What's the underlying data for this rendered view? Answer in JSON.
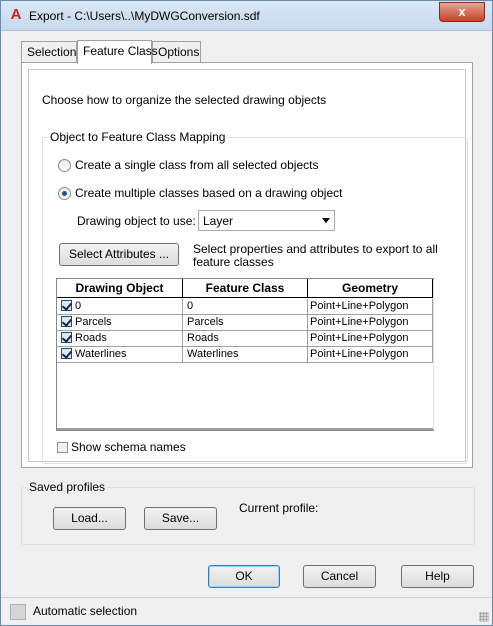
{
  "window": {
    "app_icon": "A",
    "title": "Export - C:\\Users\\..\\MyDWGConversion.sdf",
    "close_glyph": "x",
    "close_icon": "close-icon"
  },
  "tabs": [
    {
      "label": "Selection",
      "active": false
    },
    {
      "label": "Feature Class",
      "active": true
    },
    {
      "label": "Options",
      "active": false
    }
  ],
  "feature_class": {
    "intro": "Choose how to organize the selected drawing objects",
    "group_title": "Object to Feature Class Mapping",
    "radio_single": {
      "label": "Create a single class from all selected objects",
      "checked": false
    },
    "radio_multiple": {
      "label": "Create multiple classes based on a drawing object",
      "checked": true
    },
    "drawing_object_label": "Drawing object to use:",
    "drawing_object_value": "Layer",
    "select_attributes_button": "Select Attributes ...",
    "select_attributes_desc": "Select properties and attributes to export to all feature classes",
    "columns": [
      "Drawing Object",
      "Feature Class",
      "Geometry"
    ],
    "rows": [
      {
        "checked": true,
        "drawing_object": "0",
        "feature_class": "0",
        "geometry": "Point+Line+Polygon"
      },
      {
        "checked": true,
        "drawing_object": "Parcels",
        "feature_class": "Parcels",
        "geometry": "Point+Line+Polygon"
      },
      {
        "checked": true,
        "drawing_object": "Roads",
        "feature_class": "Roads",
        "geometry": "Point+Line+Polygon"
      },
      {
        "checked": true,
        "drawing_object": "Waterlines",
        "feature_class": "Waterlines",
        "geometry": "Point+Line+Polygon"
      }
    ],
    "show_schema_names": {
      "label": "Show schema names",
      "checked": false
    }
  },
  "saved_profiles": {
    "title": "Saved profiles",
    "load_button": "Load...",
    "save_button": "Save...",
    "current_profile_label": "Current profile:"
  },
  "footer": {
    "ok": "OK",
    "cancel": "Cancel",
    "help": "Help"
  },
  "status": {
    "text": "Automatic selection",
    "icon": "selection-status-icon"
  }
}
